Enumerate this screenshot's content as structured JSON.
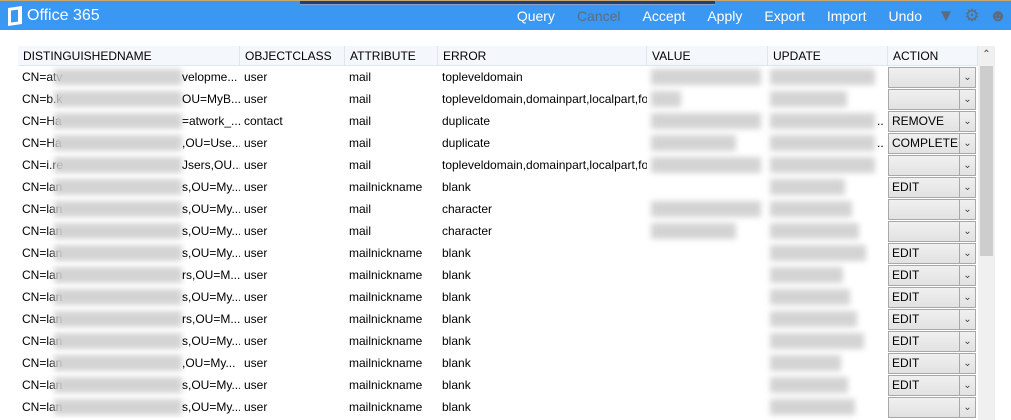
{
  "app": {
    "title": "Office 365"
  },
  "menu": {
    "query": "Query",
    "cancel": "Cancel",
    "accept": "Accept",
    "apply": "Apply",
    "export": "Export",
    "import": "Import",
    "undo": "Undo"
  },
  "columns": [
    "DISTINGUISHEDNAME",
    "OBJECTCLASS",
    "ATTRIBUTE",
    "ERROR",
    "VALUE",
    "UPDATE",
    "ACTION"
  ],
  "rows": [
    {
      "dn_start": "CN=atv",
      "dn_end": "velopme...",
      "objectclass": "user",
      "attribute": "mail",
      "error": "topleveldomain",
      "value": true,
      "update_tail": "",
      "action": ""
    },
    {
      "dn_start": "CN=b.k",
      "dn_end": "OU=MyB...",
      "objectclass": "user",
      "attribute": "mail",
      "error": "topleveldomain,domainpart,localpart,format",
      "value": true,
      "update_tail": "",
      "action": ""
    },
    {
      "dn_start": "CN=Ha",
      "dn_end": "=atwork_...",
      "objectclass": "contact",
      "attribute": "mail",
      "error": "duplicate",
      "value": true,
      "update_tail": "..",
      "action": "REMOVE"
    },
    {
      "dn_start": "CN=Ha",
      "dn_end": ",OU=Use...",
      "objectclass": "user",
      "attribute": "mail",
      "error": "duplicate",
      "value": true,
      "update_tail": "..",
      "action": "COMPLETE"
    },
    {
      "dn_start": "CN=i.re",
      "dn_end": "Jsers,OU...",
      "objectclass": "user",
      "attribute": "mail",
      "error": "topleveldomain,domainpart,localpart,format",
      "value": true,
      "update_tail": "",
      "action": ""
    },
    {
      "dn_start": "CN=lan",
      "dn_end": "s,OU=My...",
      "objectclass": "user",
      "attribute": "mailnickname",
      "error": "blank",
      "value": false,
      "update_tail": "",
      "action": "EDIT"
    },
    {
      "dn_start": "CN=lan",
      "dn_end": "s,OU=My...",
      "objectclass": "user",
      "attribute": "mail",
      "error": "character",
      "value": true,
      "update_tail": "",
      "action": ""
    },
    {
      "dn_start": "CN=lan",
      "dn_end": "s,OU=My...",
      "objectclass": "user",
      "attribute": "mail",
      "error": "character",
      "value": true,
      "update_tail": "",
      "action": ""
    },
    {
      "dn_start": "CN=lan",
      "dn_end": "s,OU=My...",
      "objectclass": "user",
      "attribute": "mailnickname",
      "error": "blank",
      "value": false,
      "update_tail": "",
      "action": "EDIT"
    },
    {
      "dn_start": "CN=lan",
      "dn_end": "rs,OU=M...",
      "objectclass": "user",
      "attribute": "mailnickname",
      "error": "blank",
      "value": false,
      "update_tail": "",
      "action": "EDIT"
    },
    {
      "dn_start": "CN=lan",
      "dn_end": "s,OU=My...",
      "objectclass": "user",
      "attribute": "mailnickname",
      "error": "blank",
      "value": false,
      "update_tail": "",
      "action": "EDIT"
    },
    {
      "dn_start": "CN=lan",
      "dn_end": "rs,OU=M...",
      "objectclass": "user",
      "attribute": "mailnickname",
      "error": "blank",
      "value": false,
      "update_tail": "",
      "action": "EDIT"
    },
    {
      "dn_start": "CN=lan",
      "dn_end": "s,OU=My...",
      "objectclass": "user",
      "attribute": "mailnickname",
      "error": "blank",
      "value": false,
      "update_tail": "",
      "action": "EDIT"
    },
    {
      "dn_start": "CN=lan",
      "dn_end": ",OU=My...",
      "objectclass": "user",
      "attribute": "mailnickname",
      "error": "blank",
      "value": false,
      "update_tail": "",
      "action": "EDIT"
    },
    {
      "dn_start": "CN=lan",
      "dn_end": "s,OU=My...",
      "objectclass": "user",
      "attribute": "mailnickname",
      "error": "blank",
      "value": false,
      "update_tail": "",
      "action": "EDIT"
    },
    {
      "dn_start": "CN=lan",
      "dn_end": "s,OU=My...",
      "objectclass": "user",
      "attribute": "mailnickname",
      "error": "blank",
      "value": false,
      "update_tail": "",
      "action": ""
    }
  ]
}
